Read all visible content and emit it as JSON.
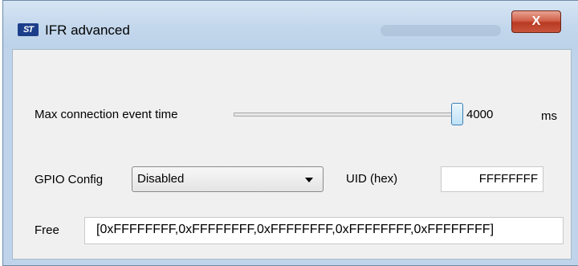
{
  "window": {
    "title": "IFR advanced",
    "logo_text": "ST",
    "close_glyph": "X",
    "accent_color": "#c9553c"
  },
  "max_connection": {
    "label": "Max connection event time",
    "slider_fraction": 1.0,
    "value": "4000",
    "unit": "ms"
  },
  "gpio": {
    "label": "GPIO Config",
    "selected": "Disabled"
  },
  "uid": {
    "label": "UID (hex)",
    "value": "FFFFFFFF"
  },
  "free": {
    "label": "Free",
    "value": "[0xFFFFFFFF,0xFFFFFFFF,0xFFFFFFFF,0xFFFFFFFF,0xFFFFFFFF]"
  }
}
